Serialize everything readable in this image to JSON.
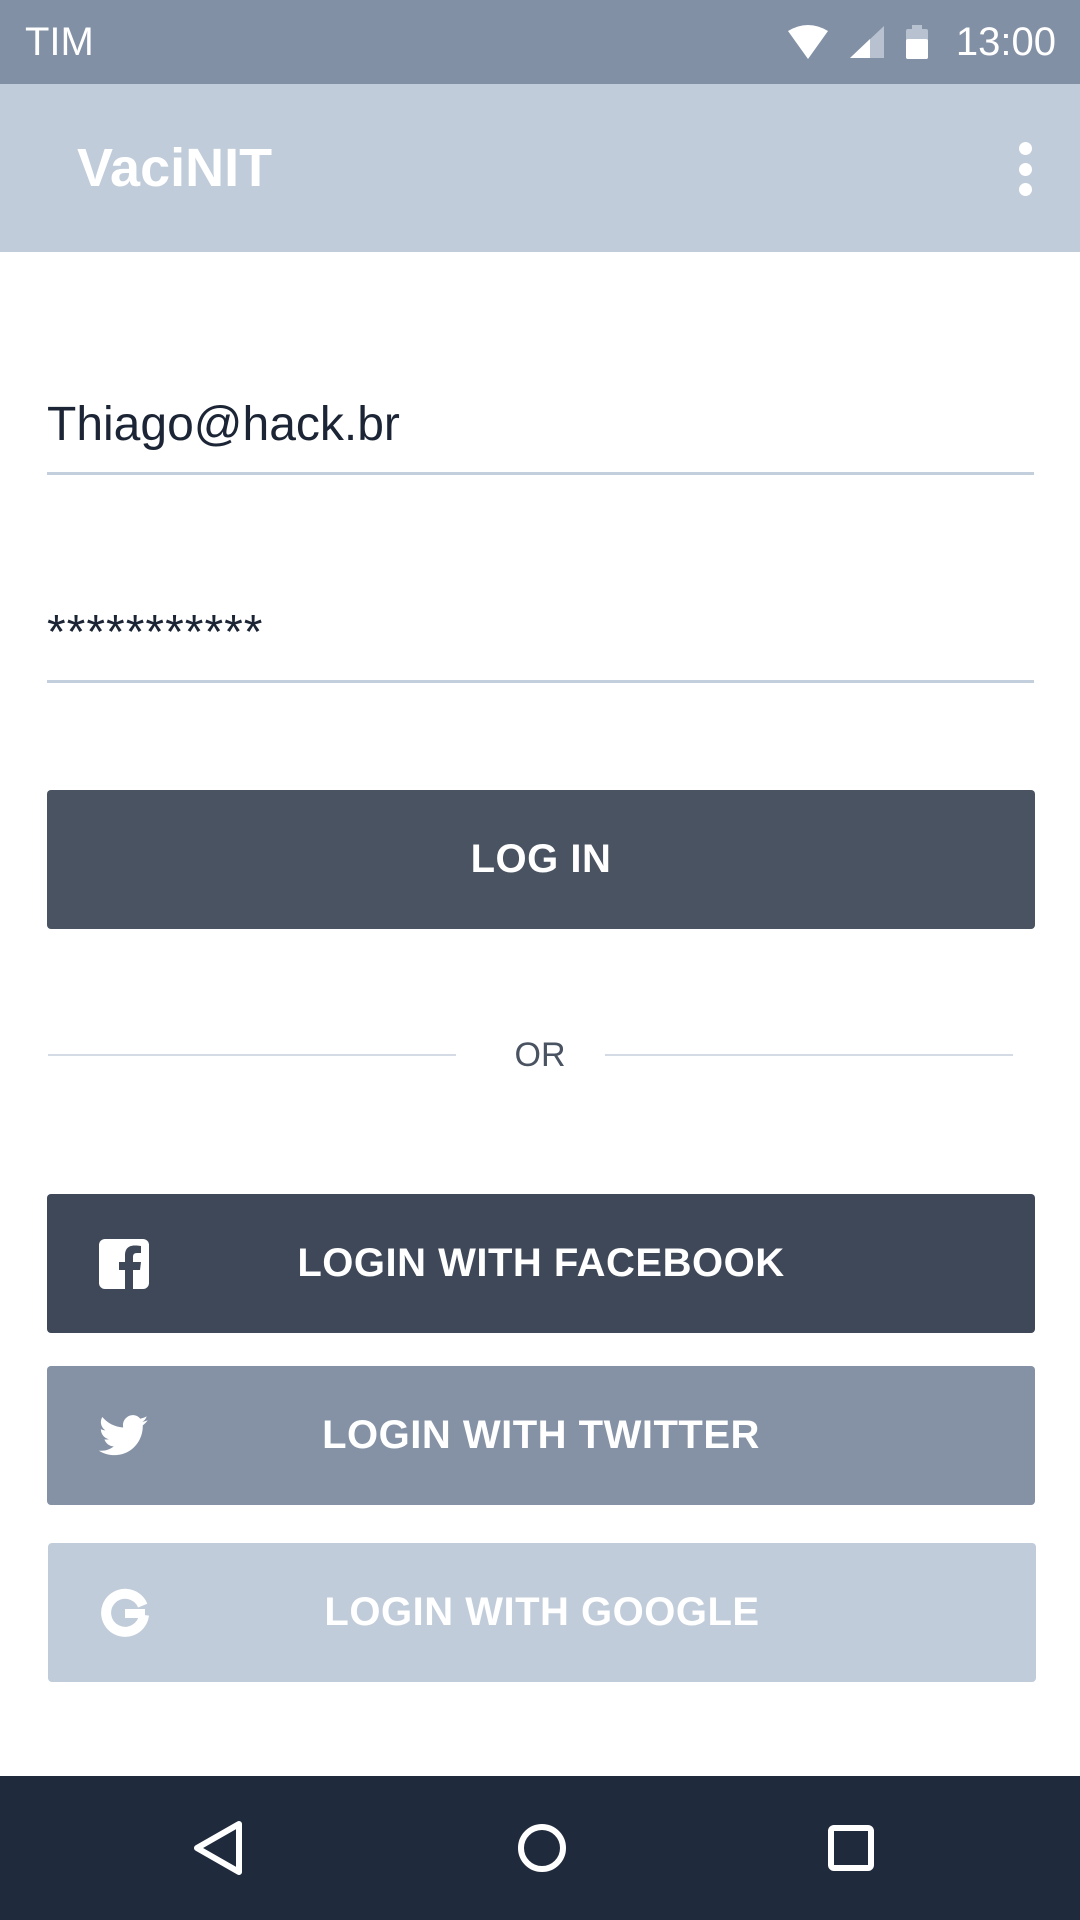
{
  "status_bar": {
    "carrier": "TIM",
    "time": "13:00",
    "icons": [
      "wifi-icon",
      "cell-signal-icon",
      "battery-icon"
    ]
  },
  "app_bar": {
    "title": "VaciNIT",
    "menu_icon": "more-vert-icon"
  },
  "form": {
    "email_value": "Thiago@hack.br",
    "password_value": "***********"
  },
  "buttons": {
    "login_label": "LOG IN",
    "or_label": "OR",
    "facebook_label": "LOGIN WITH FACEBOOK",
    "twitter_label": "LOGIN WITH TWITTER",
    "google_label": "LOGIN WITH GOOGLE"
  },
  "nav_bar": {
    "icons": [
      "back-icon",
      "home-icon",
      "recents-icon"
    ]
  },
  "colors": {
    "status_bar": "#8290a5",
    "app_bar": "#c0ccda",
    "login_button": "#4a5361",
    "facebook_button": "#3f4859",
    "twitter_button": "#8592a5",
    "google_button": "#c1ccda",
    "nav_bar": "#1f2b3c"
  }
}
